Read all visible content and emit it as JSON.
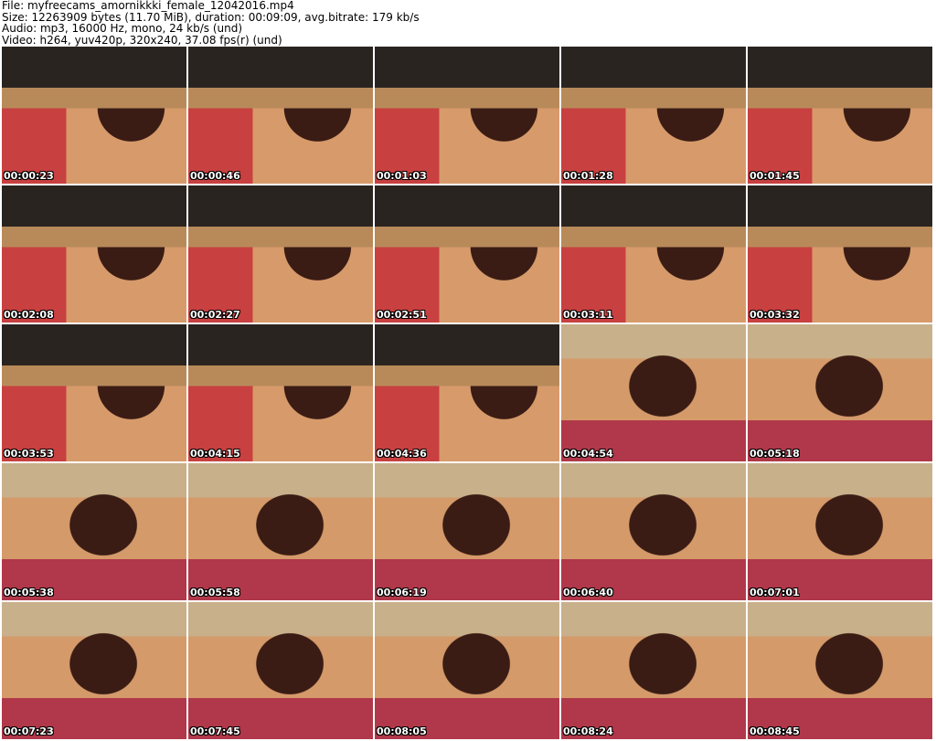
{
  "header": {
    "file": "File: myfreecams_amornikkki_female_12042016.mp4",
    "size": "Size: 12263909 bytes (11.70 MiB), duration: 00:09:09, avg.bitrate: 179 kb/s",
    "audio": "Audio: mp3, 16000 Hz, mono, 24 kb/s (und)",
    "video": "Video: h264, yuv420p, 320x240, 37.08 fps(r) (und)"
  },
  "thumbnails": [
    "00:00:23",
    "00:00:46",
    "00:01:03",
    "00:01:28",
    "00:01:45",
    "00:02:08",
    "00:02:27",
    "00:02:51",
    "00:03:11",
    "00:03:32",
    "00:03:53",
    "00:04:15",
    "00:04:36",
    "00:04:54",
    "00:05:18",
    "00:05:38",
    "00:05:58",
    "00:06:19",
    "00:06:40",
    "00:07:01",
    "00:07:23",
    "00:07:45",
    "00:08:05",
    "00:08:24",
    "00:08:45"
  ]
}
